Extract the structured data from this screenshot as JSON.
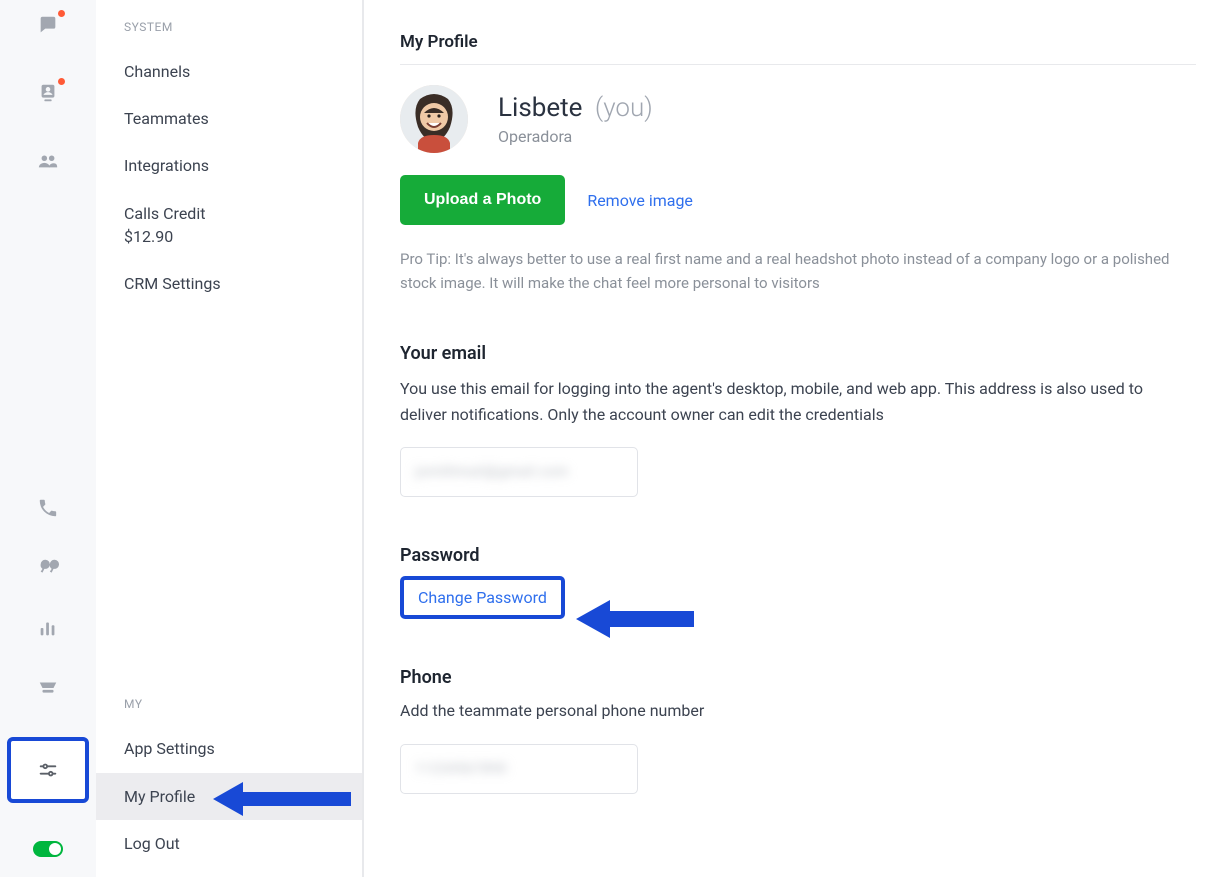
{
  "sidebar": {
    "group_system_label": "SYSTEM",
    "group_my_label": "MY",
    "system_items": {
      "channels": "Channels",
      "teammates": "Teammates",
      "integrations": "Integrations",
      "calls_credit_label": "Calls Credit",
      "calls_credit_amount": "$12.90",
      "crm_settings": "CRM Settings"
    },
    "my_items": {
      "app_settings": "App Settings",
      "my_profile": "My Profile",
      "log_out": "Log Out"
    }
  },
  "main": {
    "page_title": "My Profile",
    "profile": {
      "name": "Lisbete",
      "you_suffix": "(you)",
      "role": "Operadora"
    },
    "upload_button": "Upload a Photo",
    "remove_link": "Remove image",
    "tip": "Pro Tip: It's always better to use a real first name and a real headshot photo instead of a company logo or a polished stock image. It will make the chat feel more personal to visitors",
    "email_heading": "Your email",
    "email_desc": "You use this email for logging into the agent's desktop, mobile, and web app. This address is also used to deliver notifications. Only the account owner can edit the credentials",
    "email_value_obscured": "jsmithmail@gmail.com",
    "password_heading": "Password",
    "change_password": "Change Password",
    "phone_heading": "Phone",
    "phone_desc": "Add the teammate personal phone number",
    "phone_value_obscured": "11234567890"
  }
}
